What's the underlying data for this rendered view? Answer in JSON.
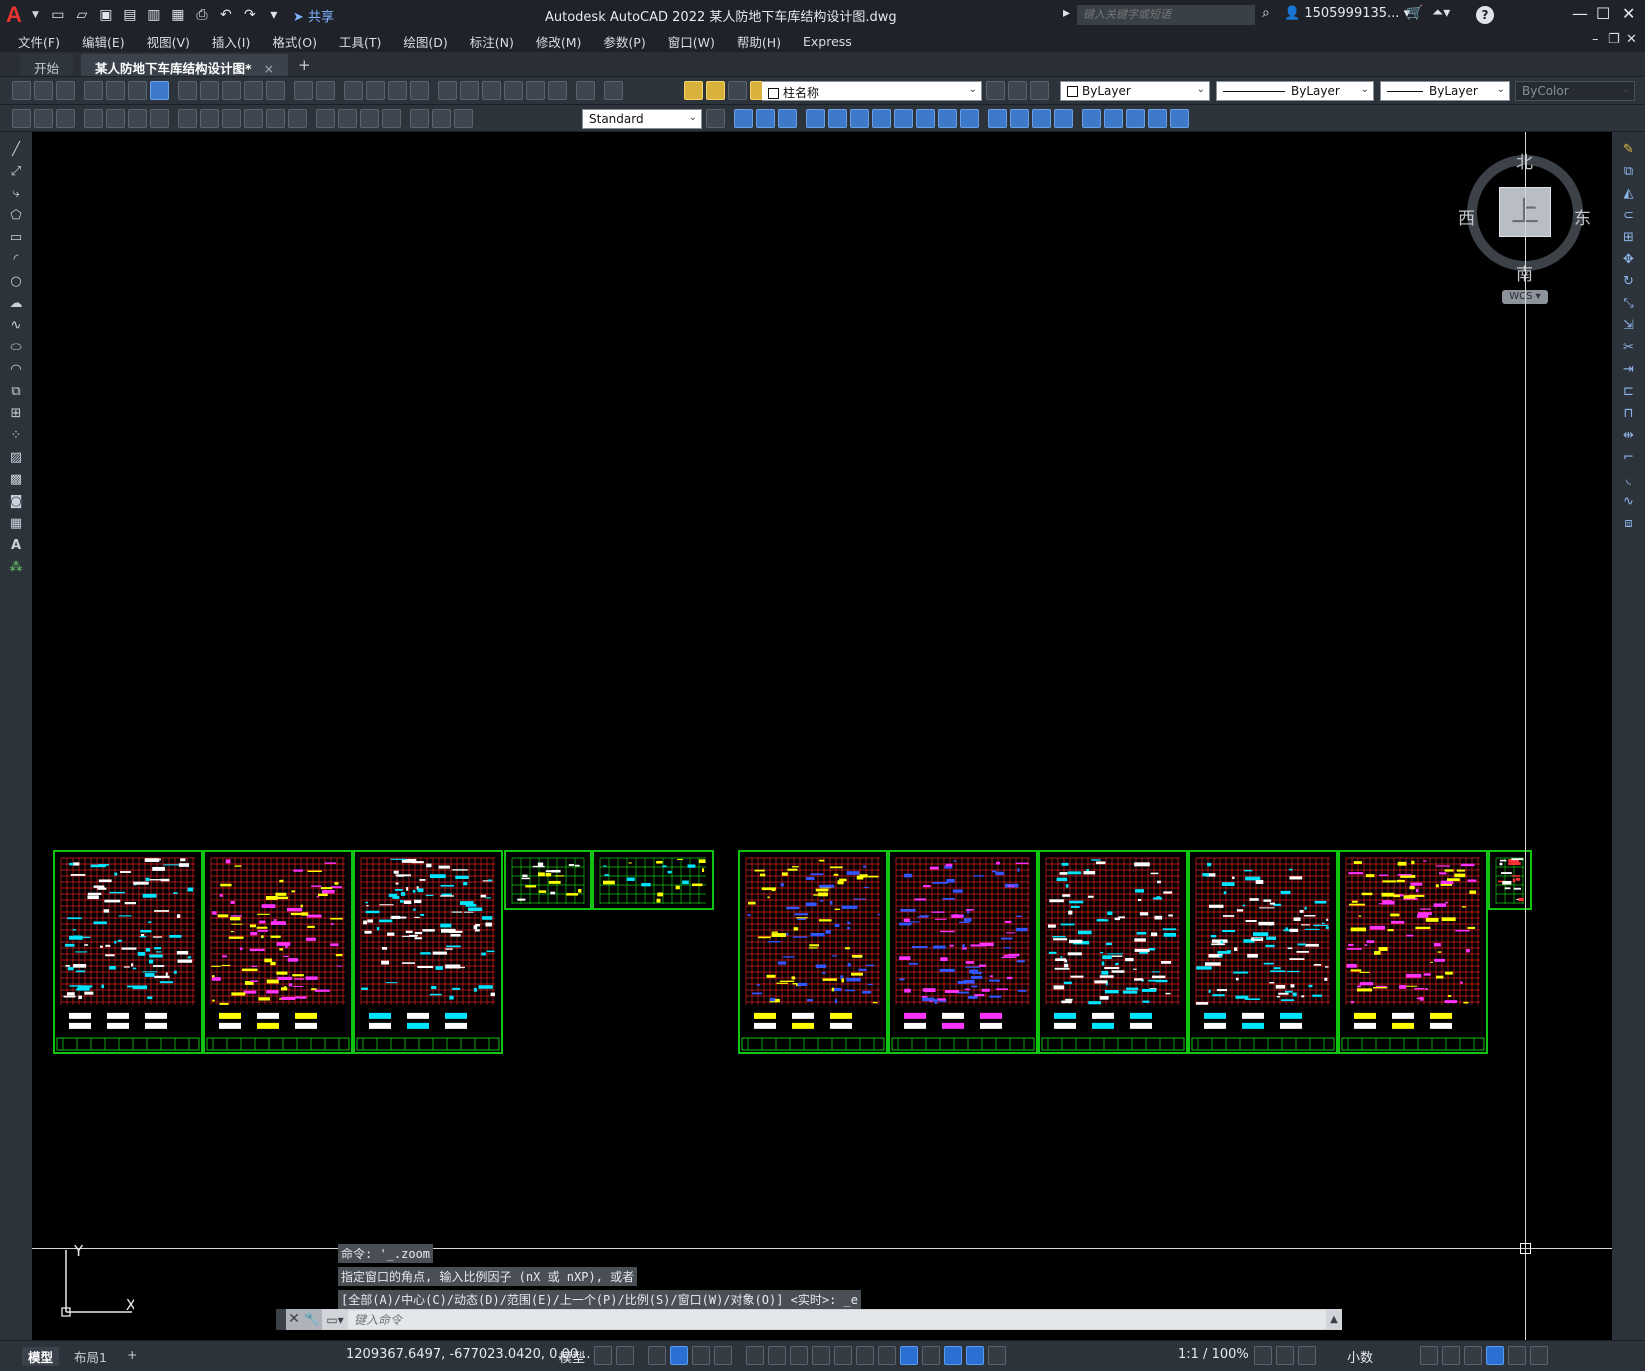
{
  "window": {
    "title": "Autodesk AutoCAD 2022    某人防地下车库结构设计图.dwg",
    "search_placeholder": "键入关键字或短语",
    "user": "1505999135...",
    "share_label": "共享"
  },
  "menu": [
    "文件(F)",
    "编辑(E)",
    "视图(V)",
    "插入(I)",
    "格式(O)",
    "工具(T)",
    "绘图(D)",
    "标注(N)",
    "修改(M)",
    "参数(P)",
    "窗口(W)",
    "帮助(H)",
    "Express"
  ],
  "tabs": {
    "start": "开始",
    "active": "某人防地下车库结构设计图*",
    "close": "×",
    "add": "+"
  },
  "toolbar": {
    "layer": "柱名称",
    "color": "ByLayer",
    "linetype": "ByLayer",
    "lineweight": "ByLayer",
    "plotstyle": "ByColor",
    "textstyle": "Standard"
  },
  "viewcube": {
    "north": "北",
    "south": "南",
    "east": "东",
    "west": "西",
    "face": "上",
    "wcs": "WCS"
  },
  "ucs": {
    "x": "X",
    "y": "Y"
  },
  "command": {
    "history": [
      "命令: '_.zoom",
      "指定窗口的角点, 输入比例因子 (nX 或 nXP), 或者",
      "[全部(A)/中心(C)/动态(D)/范围(E)/上一个(P)/比例(S)/窗口(W)/对象(O)] <实时>: _e"
    ],
    "placeholder": "键入命令"
  },
  "status": {
    "layout_model": "模型",
    "layout1": "布局1",
    "add": "+",
    "coords": "1209367.6497, -677023.0420, 0.00...",
    "model": "模型",
    "scale": "1:1 / 100%",
    "units": "小数"
  },
  "colors": {
    "sheet_border": "#11c411",
    "grid": "#e02020",
    "accent": "#2a6fd1",
    "background": "#000000"
  }
}
